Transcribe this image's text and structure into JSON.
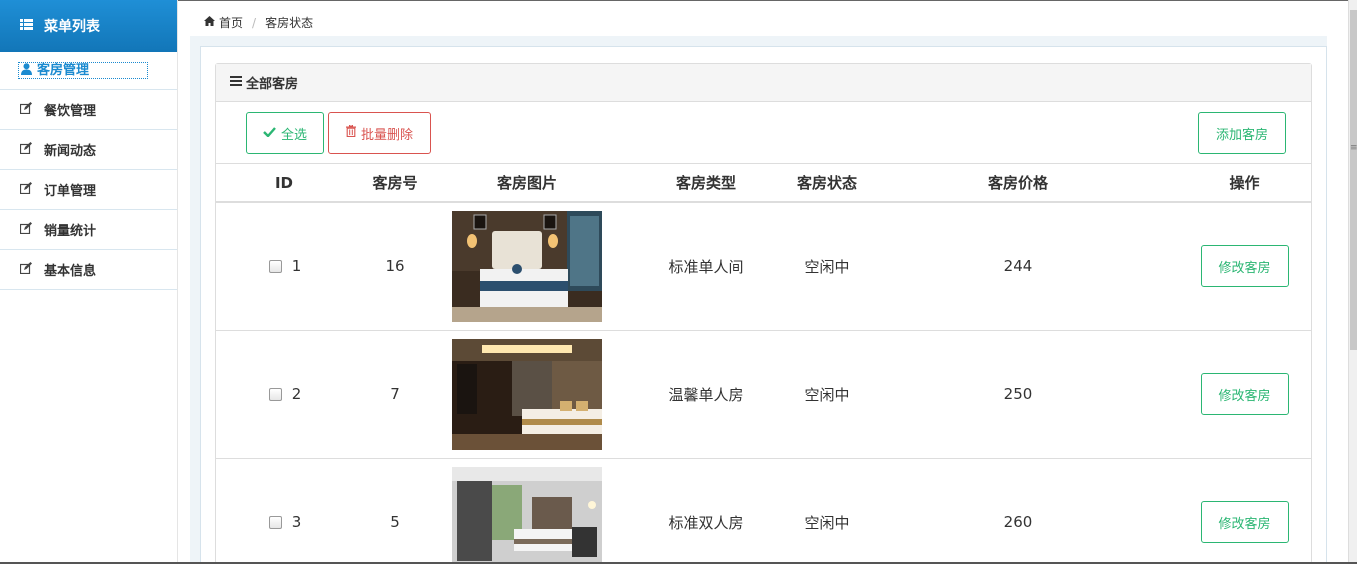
{
  "sidebar": {
    "title": "菜单列表",
    "items": [
      {
        "label": "客房管理",
        "icon": "user-icon"
      },
      {
        "label": "餐饮管理",
        "icon": "edit-icon"
      },
      {
        "label": "新闻动态",
        "icon": "edit-icon"
      },
      {
        "label": "订单管理",
        "icon": "edit-icon"
      },
      {
        "label": "销量统计",
        "icon": "edit-icon"
      },
      {
        "label": "基本信息",
        "icon": "edit-icon"
      }
    ]
  },
  "breadcrumb": {
    "home": "首页",
    "current": "客房状态"
  },
  "panel": {
    "title": "全部客房"
  },
  "toolbar": {
    "select_all": "全选",
    "batch_delete": "批量删除",
    "add_room": "添加客房"
  },
  "table": {
    "headers": [
      "ID",
      "客房号",
      "客房图片",
      "客房类型",
      "客房状态",
      "客房价格",
      "操作"
    ],
    "rows": [
      {
        "id": "1",
        "room_no": "16",
        "type": "标准单人间",
        "status": "空闲中",
        "price": "244",
        "action": "修改客房"
      },
      {
        "id": "2",
        "room_no": "7",
        "type": "温馨单人房",
        "status": "空闲中",
        "price": "250",
        "action": "修改客房"
      },
      {
        "id": "3",
        "room_no": "5",
        "type": "标准双人房",
        "status": "空闲中",
        "price": "260",
        "action": "修改客房"
      }
    ]
  },
  "colors": {
    "brand": "#1a8ad0",
    "success": "#2bb673",
    "danger": "#d9534f"
  }
}
